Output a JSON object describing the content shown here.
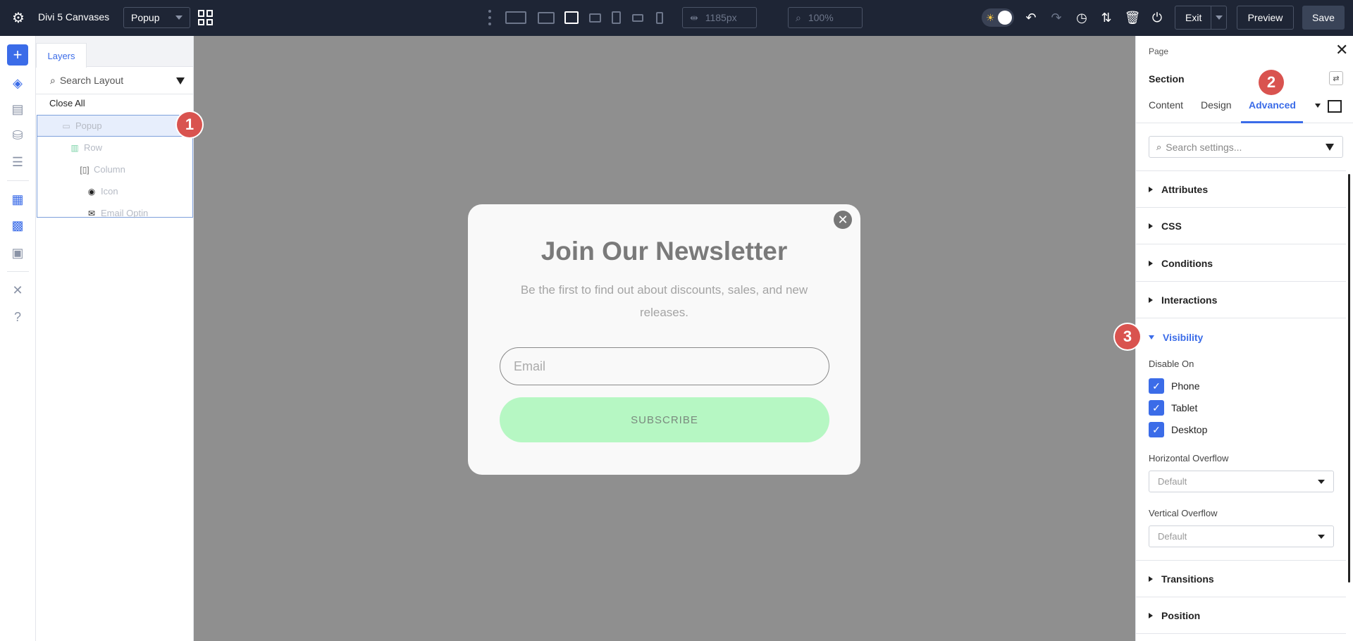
{
  "topbar": {
    "title": "Divi 5 Canvases",
    "canvas_select": "Popup",
    "width_value": "1185px",
    "zoom_value": "100%",
    "exit_label": "Exit",
    "preview_label": "Preview",
    "save_label": "Save"
  },
  "layers": {
    "tab_label": "Layers",
    "search_placeholder": "Search Layout",
    "close_all": "Close All",
    "items": [
      {
        "label": "Popup",
        "icon": "popup-icon"
      },
      {
        "label": "Row",
        "icon": "row-icon"
      },
      {
        "label": "Column",
        "icon": "column-icon"
      },
      {
        "label": "Icon",
        "icon": "target-icon"
      },
      {
        "label": "Email Optin",
        "icon": "mail-icon"
      }
    ]
  },
  "markers": [
    "1",
    "2",
    "3"
  ],
  "popup": {
    "title": "Join Our Newsletter",
    "subtitle": "Be the first to find out about discounts, sales, and new releases.",
    "email_placeholder": "Email",
    "button_label": "SUBSCRIBE"
  },
  "settings": {
    "breadcrumb": "Page",
    "section_title": "Section",
    "tabs": [
      "Content",
      "Design",
      "Advanced"
    ],
    "active_tab": "Advanced",
    "search_placeholder": "Search settings...",
    "accordions": [
      "Attributes",
      "CSS",
      "Conditions",
      "Interactions",
      "Visibility",
      "Transitions",
      "Position"
    ],
    "visibility": {
      "disable_on_label": "Disable On",
      "options": [
        {
          "label": "Phone",
          "checked": true
        },
        {
          "label": "Tablet",
          "checked": true
        },
        {
          "label": "Desktop",
          "checked": true
        }
      ],
      "horizontal_overflow_label": "Horizontal Overflow",
      "horizontal_overflow_value": "Default",
      "vertical_overflow_label": "Vertical Overflow",
      "vertical_overflow_value": "Default"
    }
  },
  "colors": {
    "accent": "#3b6ce8",
    "topbar_bg": "#1e2535",
    "marker": "#d9534f",
    "subscribe_bg": "#b6f7c3",
    "canvas_bg": "#8f8f8f"
  }
}
